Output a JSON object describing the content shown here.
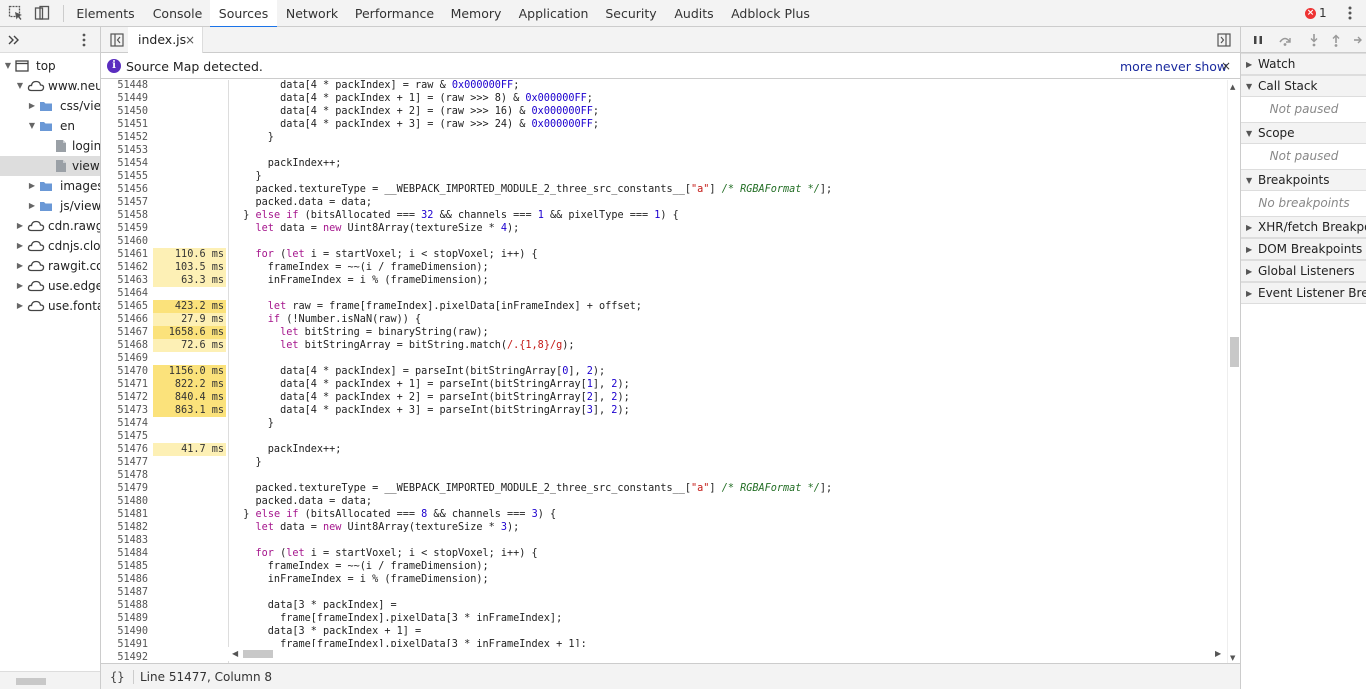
{
  "toolbar": {
    "tabs": [
      {
        "label": "Elements",
        "active": false
      },
      {
        "label": "Console",
        "active": false
      },
      {
        "label": "Sources",
        "active": true
      },
      {
        "label": "Network",
        "active": false
      },
      {
        "label": "Performance",
        "active": false
      },
      {
        "label": "Memory",
        "active": false
      },
      {
        "label": "Application",
        "active": false
      },
      {
        "label": "Security",
        "active": false
      },
      {
        "label": "Audits",
        "active": false
      },
      {
        "label": "Adblock Plus",
        "active": false
      }
    ],
    "error_count": "1",
    "icons": [
      "inspect-element-icon",
      "device-toolbar-icon",
      "error-icon",
      "kebab-menu-icon"
    ]
  },
  "navigator": {
    "tree": [
      {
        "label": "top",
        "depth": 0,
        "expanded": true,
        "icon": "frame-icon"
      },
      {
        "label": "www.neu",
        "depth": 1,
        "expanded": true,
        "icon": "cloud-icon"
      },
      {
        "label": "css/view",
        "depth": 2,
        "expanded": false,
        "icon": "folder-icon"
      },
      {
        "label": "en",
        "depth": 2,
        "expanded": true,
        "icon": "folder-icon"
      },
      {
        "label": "login",
        "depth": 3,
        "expanded": null,
        "icon": "file-icon"
      },
      {
        "label": "viewer",
        "depth": 3,
        "expanded": null,
        "icon": "file-icon",
        "selected": true
      },
      {
        "label": "images",
        "depth": 2,
        "expanded": false,
        "icon": "folder-icon"
      },
      {
        "label": "js/viewe",
        "depth": 2,
        "expanded": false,
        "icon": "folder-icon"
      },
      {
        "label": "cdn.rawgi",
        "depth": 1,
        "expanded": false,
        "icon": "cloud-icon"
      },
      {
        "label": "cdnjs.clou",
        "depth": 1,
        "expanded": false,
        "icon": "cloud-icon"
      },
      {
        "label": "rawgit.co",
        "depth": 1,
        "expanded": false,
        "icon": "cloud-icon"
      },
      {
        "label": "use.edgef",
        "depth": 1,
        "expanded": false,
        "icon": "cloud-icon"
      },
      {
        "label": "use.fonta",
        "depth": 1,
        "expanded": false,
        "icon": "cloud-icon"
      }
    ]
  },
  "editor": {
    "file_tab": "index.js",
    "close_glyph": "×",
    "info": {
      "icon_glyph": "i",
      "text": "Source Map detected.",
      "more": "more",
      "never_show": "never show",
      "close_glyph": "×"
    },
    "lines": [
      {
        "n": "51448",
        "t": "",
        "code": [
          [
            "v",
            "        data[4 "
          ],
          [
            "p",
            "* "
          ],
          [
            "v",
            "packIndex] = raw & "
          ],
          [
            "hx",
            "0x000000FF"
          ],
          [
            "p",
            ";"
          ]
        ]
      },
      {
        "n": "51449",
        "t": "",
        "code": [
          [
            "v",
            "        data[4 * packIndex + 1] = (raw >>> 8) & "
          ],
          [
            "hx",
            "0x000000FF"
          ],
          [
            "p",
            ";"
          ]
        ]
      },
      {
        "n": "51450",
        "t": "",
        "code": [
          [
            "v",
            "        data[4 * packIndex + 2] = (raw >>> 16) & "
          ],
          [
            "hx",
            "0x000000FF"
          ],
          [
            "p",
            ";"
          ]
        ]
      },
      {
        "n": "51451",
        "t": "",
        "code": [
          [
            "v",
            "        data[4 * packIndex + 3] = (raw >>> 24) & "
          ],
          [
            "hx",
            "0x000000FF"
          ],
          [
            "p",
            ";"
          ]
        ]
      },
      {
        "n": "51452",
        "t": "",
        "code": [
          [
            "p",
            "      }"
          ]
        ]
      },
      {
        "n": "51453",
        "t": "",
        "code": []
      },
      {
        "n": "51454",
        "t": "",
        "code": [
          [
            "v",
            "      packIndex++;"
          ]
        ]
      },
      {
        "n": "51455",
        "t": "",
        "code": [
          [
            "p",
            "    }"
          ]
        ]
      },
      {
        "n": "51456",
        "t": "",
        "code": [
          [
            "v",
            "    packed.textureType = __WEBPACK_IMPORTED_MODULE_2_three_src_constants__["
          ],
          [
            "s",
            "\"a\""
          ],
          [
            "v",
            "] "
          ],
          [
            "c",
            "/* RGBAFormat */"
          ],
          [
            "p",
            "];"
          ]
        ]
      },
      {
        "n": "51457",
        "t": "",
        "code": [
          [
            "v",
            "    packed.data = data;"
          ]
        ]
      },
      {
        "n": "51458",
        "t": "",
        "code": [
          [
            "p",
            "  } "
          ],
          [
            "k",
            "else if"
          ],
          [
            "v",
            " (bitsAllocated === "
          ],
          [
            "n",
            "32"
          ],
          [
            "v",
            " && channels === "
          ],
          [
            "n",
            "1"
          ],
          [
            "v",
            " && pixelType === "
          ],
          [
            "n",
            "1"
          ],
          [
            "p",
            ") {"
          ]
        ]
      },
      {
        "n": "51459",
        "t": "",
        "code": [
          [
            "k",
            "    let"
          ],
          [
            "v",
            " data = "
          ],
          [
            "k",
            "new"
          ],
          [
            "v",
            " Uint8Array(textureSize * "
          ],
          [
            "n",
            "4"
          ],
          [
            "p",
            ");"
          ]
        ]
      },
      {
        "n": "51460",
        "t": "",
        "code": []
      },
      {
        "n": "51461",
        "t": "110.6 ms",
        "heat": "warm",
        "code": [
          [
            "k",
            "    for"
          ],
          [
            "v",
            " ("
          ],
          [
            "k",
            "let"
          ],
          [
            "v",
            " i = startVoxel; i < stopVoxel; i++) {"
          ]
        ]
      },
      {
        "n": "51462",
        "t": "103.5 ms",
        "heat": "warm",
        "code": [
          [
            "v",
            "      frameIndex = ~~(i / frameDimension);"
          ]
        ]
      },
      {
        "n": "51463",
        "t": "63.3 ms",
        "heat": "warm",
        "code": [
          [
            "v",
            "      inFrameIndex = i % (frameDimension);"
          ]
        ]
      },
      {
        "n": "51464",
        "t": "",
        "code": []
      },
      {
        "n": "51465",
        "t": "423.2 ms",
        "heat": "hot",
        "code": [
          [
            "k",
            "      let"
          ],
          [
            "v",
            " raw = frame[frameIndex].pixelData[inFrameIndex] + offset;"
          ]
        ]
      },
      {
        "n": "51466",
        "t": "27.9 ms",
        "heat": "warm",
        "code": [
          [
            "k",
            "      if"
          ],
          [
            "v",
            " (!Number.isNaN(raw)) {"
          ]
        ]
      },
      {
        "n": "51467",
        "t": "1658.6 ms",
        "heat": "hot",
        "code": [
          [
            "k",
            "        let"
          ],
          [
            "v",
            " bitString = binaryString(raw);"
          ]
        ]
      },
      {
        "n": "51468",
        "t": "72.6 ms",
        "heat": "warm",
        "code": [
          [
            "k",
            "        let"
          ],
          [
            "v",
            " bitStringArray = bitString.match("
          ],
          [
            "s",
            "/.{1,8}/g"
          ],
          [
            "p",
            ");"
          ]
        ]
      },
      {
        "n": "51469",
        "t": "",
        "code": []
      },
      {
        "n": "51470",
        "t": "1156.0 ms",
        "heat": "hot",
        "code": [
          [
            "v",
            "        data[4 * packIndex] = parseInt(bitStringArray["
          ],
          [
            "n",
            "0"
          ],
          [
            "v",
            "], "
          ],
          [
            "n",
            "2"
          ],
          [
            "p",
            ");"
          ]
        ]
      },
      {
        "n": "51471",
        "t": "822.2 ms",
        "heat": "hot",
        "code": [
          [
            "v",
            "        data[4 * packIndex + 1] = parseInt(bitStringArray["
          ],
          [
            "n",
            "1"
          ],
          [
            "v",
            "], "
          ],
          [
            "n",
            "2"
          ],
          [
            "p",
            ");"
          ]
        ]
      },
      {
        "n": "51472",
        "t": "840.4 ms",
        "heat": "hot",
        "code": [
          [
            "v",
            "        data[4 * packIndex + 2] = parseInt(bitStringArray["
          ],
          [
            "n",
            "2"
          ],
          [
            "v",
            "], "
          ],
          [
            "n",
            "2"
          ],
          [
            "p",
            ");"
          ]
        ]
      },
      {
        "n": "51473",
        "t": "863.1 ms",
        "heat": "hot",
        "code": [
          [
            "v",
            "        data[4 * packIndex + 3] = parseInt(bitStringArray["
          ],
          [
            "n",
            "3"
          ],
          [
            "v",
            "], "
          ],
          [
            "n",
            "2"
          ],
          [
            "p",
            ");"
          ]
        ]
      },
      {
        "n": "51474",
        "t": "",
        "code": [
          [
            "p",
            "      }"
          ]
        ]
      },
      {
        "n": "51475",
        "t": "",
        "code": []
      },
      {
        "n": "51476",
        "t": "41.7 ms",
        "heat": "warm",
        "code": [
          [
            "v",
            "      packIndex++;"
          ]
        ]
      },
      {
        "n": "51477",
        "t": "",
        "code": [
          [
            "p",
            "    }"
          ]
        ]
      },
      {
        "n": "51478",
        "t": "",
        "code": []
      },
      {
        "n": "51479",
        "t": "",
        "code": [
          [
            "v",
            "    packed.textureType = __WEBPACK_IMPORTED_MODULE_2_three_src_constants__["
          ],
          [
            "s",
            "\"a\""
          ],
          [
            "v",
            "] "
          ],
          [
            "c",
            "/* RGBAFormat */"
          ],
          [
            "p",
            "];"
          ]
        ]
      },
      {
        "n": "51480",
        "t": "",
        "code": [
          [
            "v",
            "    packed.data = data;"
          ]
        ]
      },
      {
        "n": "51481",
        "t": "",
        "code": [
          [
            "p",
            "  } "
          ],
          [
            "k",
            "else if"
          ],
          [
            "v",
            " (bitsAllocated === "
          ],
          [
            "n",
            "8"
          ],
          [
            "v",
            " && channels === "
          ],
          [
            "n",
            "3"
          ],
          [
            "p",
            ") {"
          ]
        ]
      },
      {
        "n": "51482",
        "t": "",
        "code": [
          [
            "k",
            "    let"
          ],
          [
            "v",
            " data = "
          ],
          [
            "k",
            "new"
          ],
          [
            "v",
            " Uint8Array(textureSize * "
          ],
          [
            "n",
            "3"
          ],
          [
            "p",
            ");"
          ]
        ]
      },
      {
        "n": "51483",
        "t": "",
        "code": []
      },
      {
        "n": "51484",
        "t": "",
        "code": [
          [
            "k",
            "    for"
          ],
          [
            "v",
            " ("
          ],
          [
            "k",
            "let"
          ],
          [
            "v",
            " i = startVoxel; i < stopVoxel; i++) {"
          ]
        ]
      },
      {
        "n": "51485",
        "t": "",
        "code": [
          [
            "v",
            "      frameIndex = ~~(i / frameDimension);"
          ]
        ]
      },
      {
        "n": "51486",
        "t": "",
        "code": [
          [
            "v",
            "      inFrameIndex = i % (frameDimension);"
          ]
        ]
      },
      {
        "n": "51487",
        "t": "",
        "code": []
      },
      {
        "n": "51488",
        "t": "",
        "code": [
          [
            "v",
            "      data[3 * packIndex] ="
          ]
        ]
      },
      {
        "n": "51489",
        "t": "",
        "code": [
          [
            "v",
            "        frame[frameIndex].pixelData[3 * inFrameIndex];"
          ]
        ]
      },
      {
        "n": "51490",
        "t": "",
        "code": [
          [
            "v",
            "      data[3 * packIndex + 1] ="
          ]
        ]
      },
      {
        "n": "51491",
        "t": "",
        "code": [
          [
            "v",
            "        frame[frameIndex].pixelData[3 * inFrameIndex + 1];"
          ]
        ]
      },
      {
        "n": "51492",
        "t": "",
        "code": []
      }
    ],
    "status": {
      "braces": "{}",
      "position": "Line 51477, Column 8"
    }
  },
  "debugger": {
    "sections": [
      {
        "label": "Watch",
        "expanded": false
      },
      {
        "label": "Call Stack",
        "expanded": true,
        "body": "Not paused"
      },
      {
        "label": "Scope",
        "expanded": true,
        "body": "Not paused"
      },
      {
        "label": "Breakpoints",
        "expanded": true,
        "body": "No breakpoints"
      },
      {
        "label": "XHR/fetch Breakpoints",
        "expanded": false
      },
      {
        "label": "DOM Breakpoints",
        "expanded": false
      },
      {
        "label": "Global Listeners",
        "expanded": false
      },
      {
        "label": "Event Listener Breakpoints",
        "expanded": false
      }
    ]
  },
  "colors": {
    "accent": "#1a73e8",
    "heat_hot": "#fbe27b",
    "heat_warm": "#fdf0b5",
    "keyword": "#a5158c",
    "number": "#1c00cf",
    "string": "#c41a16",
    "comment": "#236e25"
  }
}
